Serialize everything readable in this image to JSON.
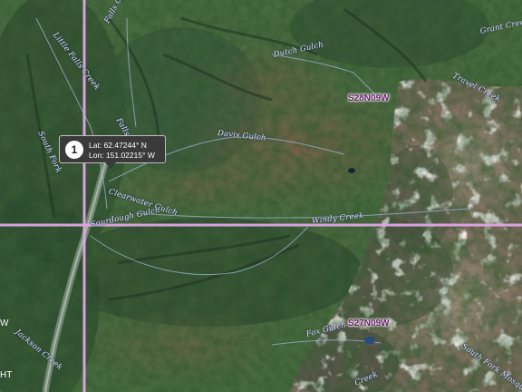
{
  "map": {
    "grid_labels": [
      "S28N09W",
      "S27N09W"
    ],
    "edge_labels": [
      "W",
      "HT"
    ],
    "features": {
      "little_falls_creek": "Little Falls Creek",
      "falls_creek_upper": "Falls Creek",
      "falls_creek_lower": "Falls Creek",
      "south_fork": "South Fork",
      "dutch_gulch": "Dutch Gulch",
      "tryout_gulch": "Davis Gulch",
      "clearwater_gulch": "Clearwater Gulch",
      "sourdough_gulch": "Sourdough Gulch",
      "windy_creek": "Windy Creek",
      "travel_creek": "Travel Creek",
      "grant_creek": "Grant Creek",
      "fox_gulch": "Fox Gulch",
      "jackson_creek": "Jackson Creek",
      "south_fork_bottom": "South Fork Mosquito",
      "creek_bottom": "Creek"
    },
    "marker": {
      "number": "1",
      "lat": "Lat: 62.47244° N",
      "lon": "Lon: 151.02215° W"
    },
    "colors": {
      "grid_line": "#e2a6e8",
      "label_text": "#dfe6ff",
      "popup_bg": "#3a3a3a"
    }
  }
}
